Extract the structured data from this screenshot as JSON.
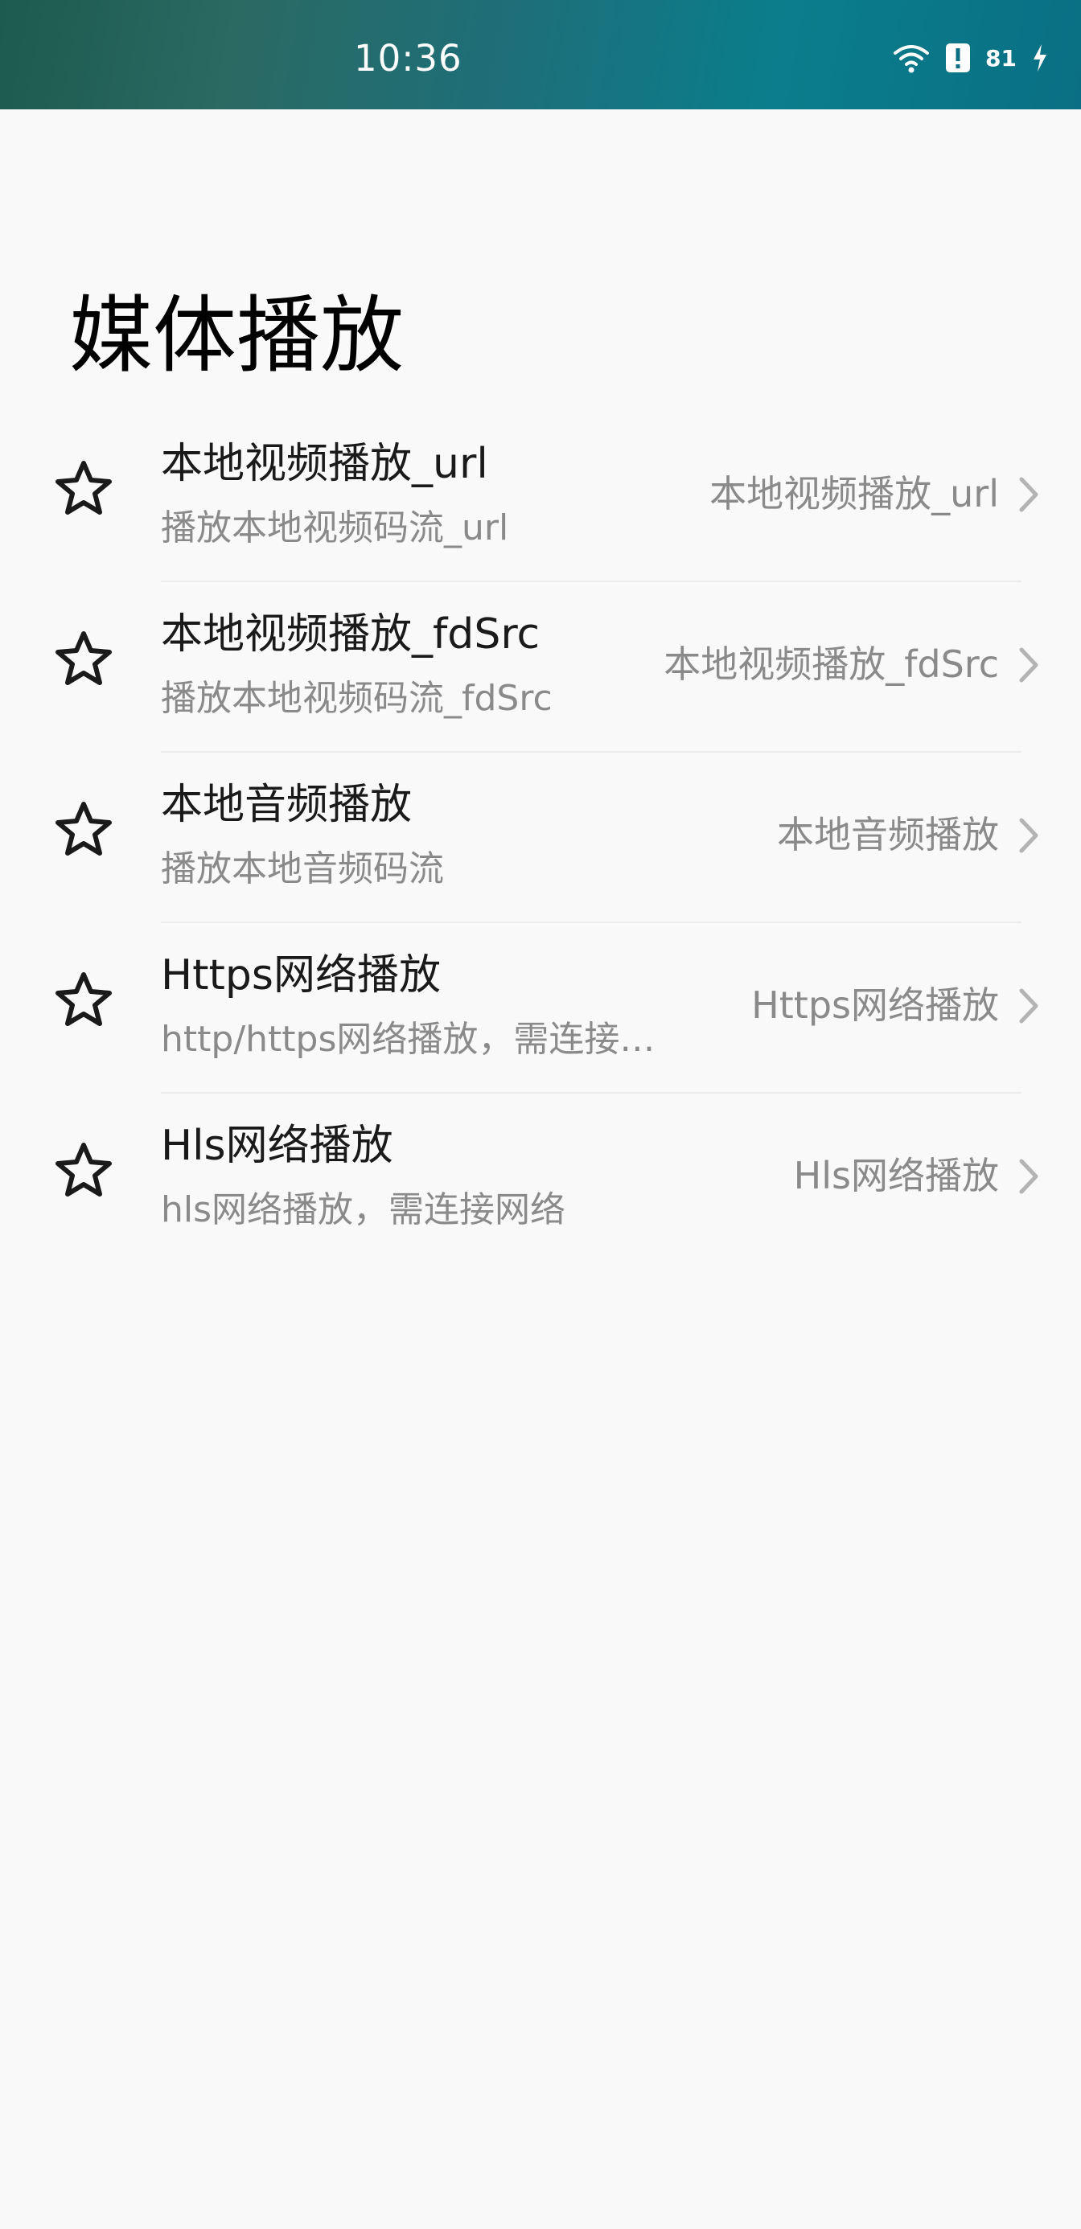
{
  "status_bar": {
    "time": "10:36",
    "battery": "81"
  },
  "page": {
    "title": "媒体播放"
  },
  "items": [
    {
      "title": "本地视频播放_url",
      "subtitle": "播放本地视频码流_url",
      "value": "本地视频播放_url"
    },
    {
      "title": "本地视频播放_fdSrc",
      "subtitle": "播放本地视频码流_fdSrc",
      "value": "本地视频播放_fdSrc"
    },
    {
      "title": "本地音频播放",
      "subtitle": "播放本地音频码流",
      "value": "本地音频播放"
    },
    {
      "title": "Https网络播放",
      "subtitle": "http/https网络播放，需连接…",
      "value": "Https网络播放"
    },
    {
      "title": "Hls网络播放",
      "subtitle": "hls网络播放，需连接网络",
      "value": "Hls网络播放"
    }
  ]
}
